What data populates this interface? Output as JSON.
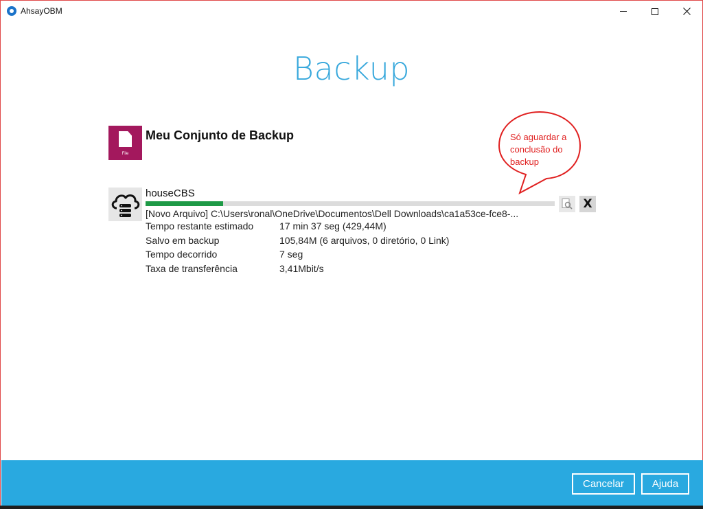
{
  "window": {
    "title": "AhsayOBM"
  },
  "page": {
    "title": "Backup"
  },
  "backup_set": {
    "name": "Meu Conjunto de Backup",
    "icon_label": "File"
  },
  "destination": {
    "name": "houseCBS",
    "progress": 0.19,
    "current_file": "[Novo Arquivo] C:\\Users\\ronal\\OneDrive\\Documentos\\Dell Downloads\\ca1a53ce-fce8-...",
    "stats": [
      {
        "label": "Tempo restante estimado",
        "value": "17 min 37 seg (429,44M)"
      },
      {
        "label": "Salvo em backup",
        "value": "105,84M (6 arquivos, 0 diretório, 0 Link)"
      },
      {
        "label": "Tempo decorrido",
        "value": "7 seg"
      },
      {
        "label": "Taxa de transferência",
        "value": "3,41Mbit/s"
      }
    ],
    "cancel_glyph": "X"
  },
  "annotation": {
    "lines": [
      "Só aguardar a",
      "conclusão do",
      "backup"
    ],
    "color": "#e02020"
  },
  "footer": {
    "cancel_label": "Cancelar",
    "help_label": "Ajuda"
  },
  "colors": {
    "accent": "#29a9e0",
    "title": "#37a8dc",
    "progress": "#1e9a46",
    "file_icon": "#a3185d"
  }
}
